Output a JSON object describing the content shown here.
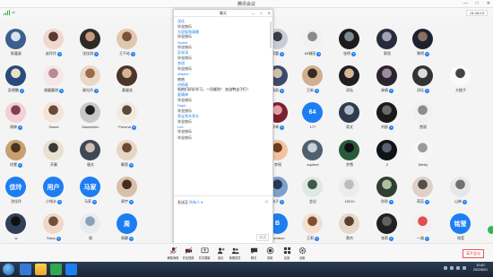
{
  "window": {
    "title": "腾讯会议",
    "controls": [
      "—",
      "□",
      "✕"
    ]
  },
  "status": {
    "signal_label": "all",
    "timer": "01:28:13"
  },
  "colors": {
    "accent": "#1d7ef2",
    "end": "#e0393e"
  },
  "participants": [
    {
      "name": "陈嘉豪",
      "muted": false,
      "type": "img",
      "c1": "#3b5f8f",
      "c2": "#d7e3ef"
    },
    {
      "name": "赵玲玲",
      "muted": true,
      "type": "img",
      "c1": "#f0d8d0",
      "c2": "#5c3a33"
    },
    {
      "name": "沈佳琪",
      "muted": true,
      "type": "img",
      "c1": "#2f2a28",
      "c2": "#c79a7e"
    },
    {
      "name": "王千屹",
      "muted": true,
      "type": "img",
      "c1": "#e0c8b0",
      "c2": "#7a5238"
    },
    {
      "name": "",
      "muted": false,
      "type": "none"
    },
    {
      "name": "",
      "muted": false,
      "type": "none"
    },
    {
      "name": "",
      "muted": false,
      "type": "none"
    },
    {
      "name": "蒋蕾",
      "muted": true,
      "type": "img",
      "c1": "#c9ccd6",
      "c2": "#3b3b44"
    },
    {
      "name": "69城班",
      "muted": true,
      "type": "img",
      "c1": "#f1f1f1",
      "c2": "#8a8a8a"
    },
    {
      "name": "张明",
      "muted": true,
      "type": "img",
      "c1": "#1b1b1b",
      "c2": "#7c8a90"
    },
    {
      "name": "郭思",
      "muted": false,
      "type": "img",
      "c1": "#272c3d",
      "c2": "#a3a0b8"
    },
    {
      "name": "黎明",
      "muted": true,
      "type": "img",
      "c1": "#1c2230",
      "c2": "#8b6f5f"
    },
    {
      "name": "",
      "muted": false,
      "type": "none"
    },
    {
      "name": "彭德鹏",
      "muted": true,
      "type": "img",
      "c1": "#2a4a7a",
      "c2": "#e8e0c8"
    },
    {
      "name": "谢圆圆琪",
      "muted": true,
      "type": "img",
      "c1": "#f6e6ea",
      "c2": "#b48c96"
    },
    {
      "name": "谢光玲",
      "muted": true,
      "type": "img",
      "c1": "#e8d8c8",
      "c2": "#9c6a4a"
    },
    {
      "name": "黄骊花",
      "muted": false,
      "type": "img",
      "c1": "#4c3428",
      "c2": "#d2b594"
    },
    {
      "name": "",
      "muted": false,
      "type": "none"
    },
    {
      "name": "",
      "muted": false,
      "type": "none"
    },
    {
      "name": "",
      "muted": false,
      "type": "none"
    },
    {
      "name": "杨雨",
      "muted": true,
      "type": "img",
      "c1": "#3c4a6a",
      "c2": "#cfc0a8"
    },
    {
      "name": "王新",
      "muted": true,
      "type": "img",
      "c1": "#d0b090",
      "c2": "#3a2a20"
    },
    {
      "name": "邓弘",
      "muted": false,
      "type": "img",
      "c1": "#1e1e24",
      "c2": "#d8b890"
    },
    {
      "name": "林倩",
      "muted": true,
      "type": "img",
      "c1": "#2a2430",
      "c2": "#9c8c9c"
    },
    {
      "name": "邓佳",
      "muted": true,
      "type": "img",
      "c1": "#333333",
      "c2": "#dcdcdc"
    },
    {
      "name": "大橙子",
      "muted": false,
      "type": "img",
      "c1": "#fafafa",
      "c2": "#444444"
    },
    {
      "name": "周婷",
      "muted": true,
      "type": "img",
      "c1": "#f2d0d6",
      "c2": "#804050"
    },
    {
      "name": "Sweet",
      "muted": false,
      "type": "img",
      "c1": "#f4e4d8",
      "c2": "#6b4a3a"
    },
    {
      "name": "Maximilien",
      "muted": false,
      "type": "img",
      "c1": "#c8c8c8",
      "c2": "#202020"
    },
    {
      "name": "Purzma",
      "muted": true,
      "type": "img",
      "c1": "#f0eadf",
      "c2": "#5a4a3a"
    },
    {
      "name": "",
      "muted": false,
      "type": "none"
    },
    {
      "name": "",
      "muted": false,
      "type": "none"
    },
    {
      "name": "",
      "muted": false,
      "type": "none"
    },
    {
      "name": "勇琴",
      "muted": true,
      "type": "img",
      "c1": "#7a2030",
      "c2": "#e0a0a0"
    },
    {
      "name": "177",
      "muted": false,
      "type": "text",
      "text": "64"
    },
    {
      "name": "蒋文",
      "muted": false,
      "type": "img",
      "c1": "#2e3a4e",
      "c2": "#b0bccc"
    },
    {
      "name": "刘俊",
      "muted": true,
      "type": "img",
      "c1": "#1a1a1a",
      "c2": "#6a6a6a"
    },
    {
      "name": "贾丽",
      "muted": false,
      "type": "img",
      "c1": "#f0f0f0",
      "c2": "#8c8c8c"
    },
    {
      "name": "",
      "muted": false,
      "type": "none"
    },
    {
      "name": "徐雯",
      "muted": true,
      "type": "img",
      "c1": "#c8a070",
      "c2": "#4a3420"
    },
    {
      "name": "开靓",
      "muted": false,
      "type": "img",
      "c1": "#e8e0d0",
      "c2": "#3a3a3a"
    },
    {
      "name": "唐文",
      "muted": false,
      "type": "img",
      "c1": "#404858",
      "c2": "#d0c0b0"
    },
    {
      "name": "解蓓",
      "muted": true,
      "type": "img",
      "c1": "#e8d6c4",
      "c2": "#6a4a30"
    },
    {
      "name": "",
      "muted": false,
      "type": "none"
    },
    {
      "name": "",
      "muted": false,
      "type": "none"
    },
    {
      "name": "",
      "muted": false,
      "type": "none"
    },
    {
      "name": "李瑶",
      "muted": false,
      "type": "img",
      "c1": "#f0c4a0",
      "c2": "#703c20"
    },
    {
      "name": "squirrel",
      "muted": false,
      "type": "img",
      "c1": "#506070",
      "c2": "#c8d0d8"
    },
    {
      "name": "余雪",
      "muted": false,
      "type": "img",
      "c1": "#2a5a3a",
      "c2": "#101010"
    },
    {
      "name": "Z",
      "muted": false,
      "type": "img",
      "c1": "#101418",
      "c2": "#5a6070"
    },
    {
      "name": "Mesly",
      "muted": false,
      "type": "img",
      "c1": "#f6f6f6",
      "c2": "#9a9a9a"
    },
    {
      "name": "",
      "muted": false,
      "type": "none"
    },
    {
      "name": "沈佳玲",
      "muted": false,
      "type": "text",
      "text": "佳玲"
    },
    {
      "name": "小钱水",
      "muted": true,
      "type": "text",
      "text": "用户"
    },
    {
      "name": "马家",
      "muted": true,
      "type": "text",
      "text": "马家"
    },
    {
      "name": "周宇",
      "muted": true,
      "type": "img",
      "c1": "#d8c0a8",
      "c2": "#4a2c1c"
    },
    {
      "name": "",
      "muted": false,
      "type": "none"
    },
    {
      "name": "",
      "muted": false,
      "type": "none"
    },
    {
      "name": "",
      "muted": false,
      "type": "none"
    },
    {
      "name": "柚子",
      "muted": true,
      "type": "img",
      "c1": "#7aa0d0",
      "c2": "#283850"
    },
    {
      "name": "会议",
      "muted": false,
      "type": "img",
      "c1": "#e0e8e4",
      "c2": "#3a5a4a"
    },
    {
      "name": "15210",
      "muted": false,
      "type": "img",
      "c1": "#ececec",
      "c2": "#bdbdbd"
    },
    {
      "name": "彤彤",
      "muted": true,
      "type": "img",
      "c1": "#304030",
      "c2": "#b0c0a0"
    },
    {
      "name": "蒋蕊",
      "muted": true,
      "type": "img",
      "c1": "#e0d0c8",
      "c2": "#505050"
    },
    {
      "name": "山神",
      "muted": true,
      "type": "img",
      "c1": "#e8e8e8",
      "c2": "#707070"
    },
    {
      "name": "w",
      "muted": false,
      "type": "img",
      "c1": "#304058",
      "c2": "#101010"
    },
    {
      "name": "Stacy",
      "muted": true,
      "type": "img",
      "c1": "#f0d8c8",
      "c2": "#70503c"
    },
    {
      "name": "周",
      "muted": false,
      "type": "img",
      "c1": "#e8ecf0",
      "c2": "#8ca0b4"
    },
    {
      "name": "周静",
      "muted": true,
      "type": "text",
      "text": "周"
    },
    {
      "name": "",
      "muted": false,
      "type": "none"
    },
    {
      "name": "",
      "muted": false,
      "type": "none"
    },
    {
      "name": "",
      "muted": false,
      "type": "none"
    },
    {
      "name": "Bamboo",
      "muted": false,
      "type": "text",
      "text": "B"
    },
    {
      "name": "王莉",
      "muted": true,
      "type": "img",
      "c1": "#f4e0d0",
      "c2": "#805030"
    },
    {
      "name": "黄杰",
      "muted": false,
      "type": "img",
      "c1": "#e8d8c8",
      "c2": "#5a4030"
    },
    {
      "name": "张莉",
      "muted": true,
      "type": "img",
      "c1": "#202020",
      "c2": "#606060"
    },
    {
      "name": "一路",
      "muted": true,
      "type": "img",
      "c1": "#f4f0f0",
      "c2": "#e05050"
    },
    {
      "name": "铭莹",
      "muted": false,
      "type": "text",
      "text": "铭莹"
    }
  ],
  "chat": {
    "title": "聊天",
    "window_controls": [
      "—",
      "□",
      "✕"
    ],
    "messages": [
      {
        "sender": "沈佳",
        "text": "毕业快乐"
      },
      {
        "sender": "大屁股和乘桶",
        "text": "毕业快乐"
      },
      {
        "sender": "Sweet",
        "text": "毕业快乐"
      },
      {
        "sender": "彭宋涛",
        "text": "毕业快乐"
      },
      {
        "sender": "李琪",
        "text": "毕业快乐"
      },
      {
        "sender": "Wiwen~",
        "text": "哈哈"
      },
      {
        "sender": "刘炳青",
        "text": "祝他们好好学习，一切顺利！ 加油鸭宝子们！"
      },
      {
        "sender": "夏晴婷",
        "text": "毕业快乐"
      },
      {
        "sender": "Sapri",
        "text": "毕业快乐"
      },
      {
        "sender": "乖宝乖木乖头",
        "text": "毕业快乐"
      },
      {
        "sender": "Lee",
        "text": "毕业快乐"
      },
      {
        "sender": "",
        "text": "毕业快乐"
      }
    ],
    "to_prefix": "发送至",
    "to_target": "所有人 ▾",
    "send_label": "发送"
  },
  "controls": [
    {
      "label": "解除静音",
      "icon": "mic-icon"
    },
    {
      "label": "开启视频",
      "icon": "camera-icon"
    },
    {
      "label": "共享屏幕",
      "icon": "share-screen-icon"
    },
    {
      "label": "邀请",
      "icon": "invite-icon"
    },
    {
      "label": "管理成员",
      "icon": "members-icon"
    },
    {
      "label": "聊天",
      "icon": "chat-icon"
    },
    {
      "label": "录制",
      "icon": "record-icon"
    },
    {
      "label": "应用",
      "icon": "apps-icon"
    },
    {
      "label": "设置",
      "icon": "settings-icon"
    }
  ],
  "end_label": "离开会议",
  "taskbar": {
    "time": "10:40",
    "date": "2022/6/21"
  }
}
